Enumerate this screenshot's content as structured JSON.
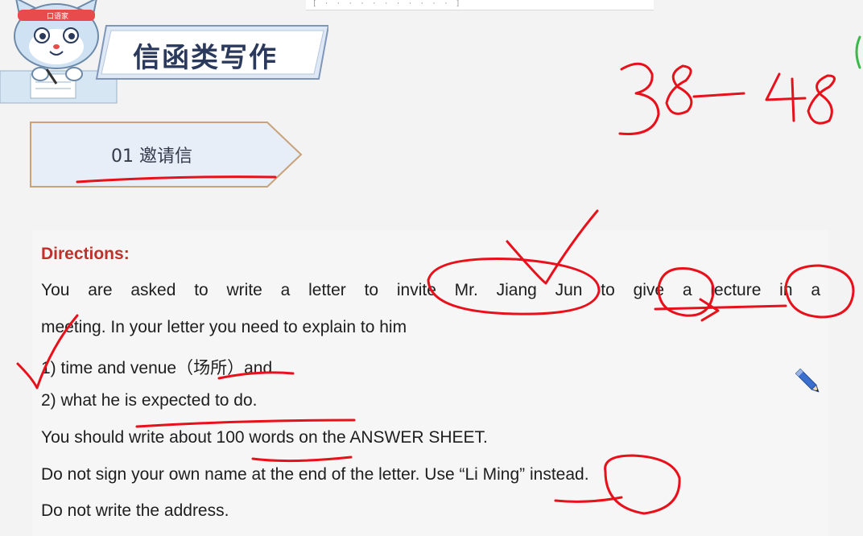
{
  "header": {
    "top_strip_text": "[ ·  ·  ·  ·  ·  ·  ·  ·  ·  ·  ·  ]",
    "title": "信函类写作",
    "mascot_headband": "口语家"
  },
  "section": {
    "label": "01 邀请信"
  },
  "directions": {
    "heading": "Directions:",
    "lines": [
      "You are asked to write a letter to invite Mr. Jiang Jun to give a lecture in a",
      "meeting. In your letter you need to explain to him",
      "1) time and venue（场所）and",
      "2) what he is expected to do.",
      "You should write about 100 words on the ANSWER SHEET.",
      "Do not sign your own name at the end of the letter. Use “Li Ming” instead.",
      "Do not write the address."
    ]
  },
  "annotations": {
    "handwritten_number": "38—48",
    "ink_color": "#e8101a"
  },
  "icons": {
    "edit": "pencil-icon"
  }
}
